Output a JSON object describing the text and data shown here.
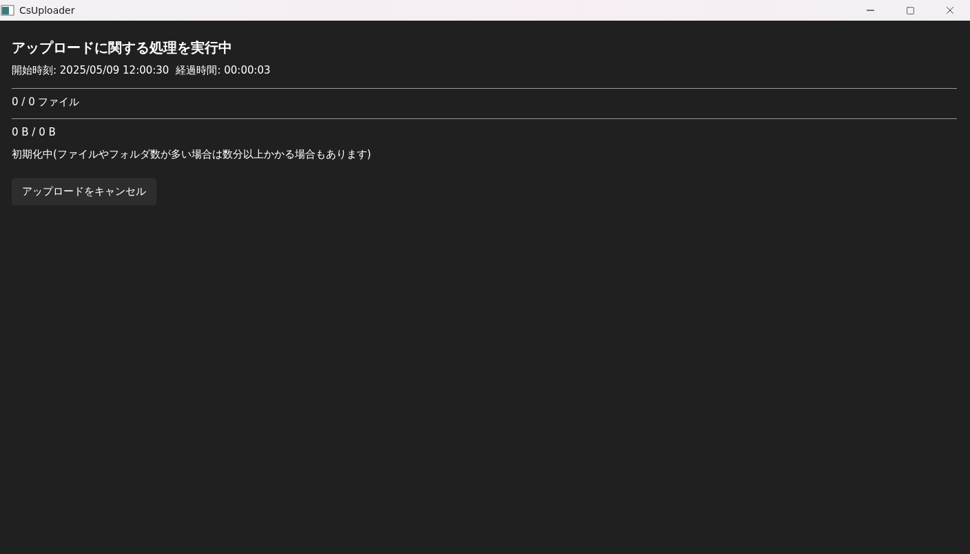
{
  "window": {
    "title": "CsUploader"
  },
  "heading": "アップロードに関する処理を実行中",
  "timing": {
    "start": "開始時刻: 2025/05/09 12:00:30",
    "elapsed": "経過時間: 00:00:03"
  },
  "files": "0 / 0 ファイル",
  "bytes": "0 B / 0 B",
  "status": "初期化中(ファイルやフォルダ数が多い場合は数分以上かかる場合もあります)",
  "buttons": [
    {
      "label": "アップロードをキャンセル"
    }
  ]
}
